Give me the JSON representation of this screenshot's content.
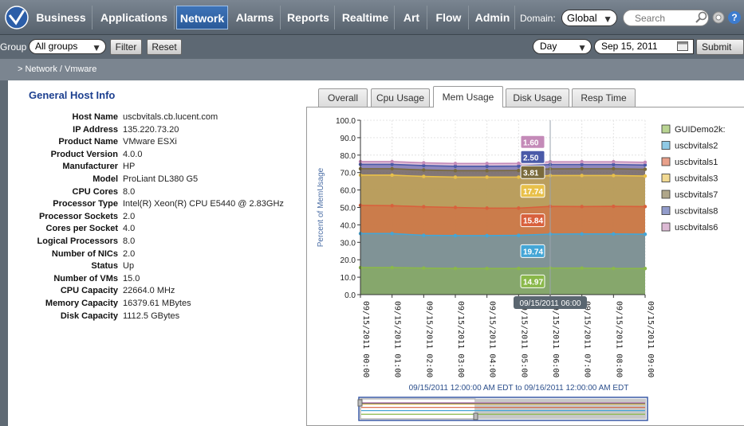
{
  "nav": {
    "items": [
      "Business",
      "Applications",
      "Network",
      "Alarms",
      "Reports",
      "Realtime",
      "Art",
      "Flow",
      "Admin"
    ],
    "active": "Network",
    "domain_label": "Domain:",
    "domain_value": "Global",
    "search_placeholder": "Search",
    "help_label": "?"
  },
  "filter": {
    "group_label": "Group",
    "group_value": "All groups",
    "filter_button": "Filter",
    "reset_button": "Reset",
    "period_value": "Day",
    "date_value": "Sep 15, 2011",
    "submit_button": "Submit"
  },
  "breadcrumb": "> Network / Vmware",
  "host_info": {
    "title": "General Host Info",
    "rows": [
      {
        "key": "Host Name",
        "value": "uscbvitals.cb.lucent.com"
      },
      {
        "key": "IP Address",
        "value": "135.220.73.20"
      },
      {
        "key": "Product Name",
        "value": "VMware ESXi"
      },
      {
        "key": "Product Version",
        "value": "4.0.0"
      },
      {
        "key": "Manufacturer",
        "value": "HP"
      },
      {
        "key": "Model",
        "value": "ProLiant DL380 G5"
      },
      {
        "key": "CPU Cores",
        "value": "8.0"
      },
      {
        "key": "Processor Type",
        "value": "Intel(R) Xeon(R) CPU E5440 @ 2.83GHz"
      },
      {
        "key": "Processor Sockets",
        "value": "2.0"
      },
      {
        "key": "Cores per Socket",
        "value": "4.0"
      },
      {
        "key": "Logical Processors",
        "value": "8.0"
      },
      {
        "key": "Number of NICs",
        "value": "2.0"
      },
      {
        "key": "Status",
        "value": "Up"
      },
      {
        "key": "Number of VMs",
        "value": "15.0"
      },
      {
        "key": "CPU Capacity",
        "value": "22664.0 MHz"
      },
      {
        "key": "Memory Capacity",
        "value": "16379.61 MBytes"
      },
      {
        "key": "Disk Capacity",
        "value": "1112.5 GBytes"
      }
    ]
  },
  "tabs": [
    "Overall",
    "Cpu Usage",
    "Mem Usage",
    "Disk Usage",
    "Resp Time"
  ],
  "active_tab": "Mem Usage",
  "chart_data": {
    "type": "area",
    "ylabel": "Percent of MemUsage",
    "ylim": [
      0,
      100
    ],
    "yticks": [
      "100.0",
      "90.0",
      "80.0",
      "70.0",
      "60.0",
      "50.0",
      "40.0",
      "30.0",
      "20.0",
      "10.0",
      "0.0"
    ],
    "x": [
      "09/15/2011 00:00",
      "09/15/2011 01:00",
      "09/15/2011 02:00",
      "09/15/2011 03:00",
      "09/15/2011 04:00",
      "09/15/2011 05:00",
      "09/15/2011 06:00",
      "09/15/2011 07:00",
      "09/15/2011 08:00",
      "09/15/2011 09:00"
    ],
    "series": [
      {
        "name": "GUIDemo2k:",
        "color": "#8ab84a",
        "cum": [
          15.5,
          15.5,
          15.2,
          15.0,
          15.0,
          15.0,
          15.2,
          15.2,
          15.0,
          15.0
        ]
      },
      {
        "name": "uscbvitals2",
        "color": "#44a6d6",
        "cum": [
          35.0,
          35.0,
          34.0,
          33.8,
          33.8,
          34.0,
          34.7,
          34.8,
          34.8,
          34.6
        ]
      },
      {
        "name": "uscbvitals1",
        "color": "#d8603c",
        "cum": [
          51.2,
          51.0,
          50.4,
          50.0,
          49.6,
          49.6,
          50.6,
          50.5,
          50.6,
          50.5
        ]
      },
      {
        "name": "uscbvitals3",
        "color": "#e8c04a",
        "cum": [
          68.5,
          68.5,
          67.8,
          67.4,
          67.4,
          67.4,
          68.3,
          68.3,
          68.3,
          68.0
        ]
      },
      {
        "name": "uscbvitals7",
        "color": "#7a6a3c",
        "cum": [
          72.2,
          72.2,
          71.5,
          71.1,
          71.1,
          71.2,
          72.1,
          72.2,
          72.2,
          71.9
        ]
      },
      {
        "name": "uscbvitals8",
        "color": "#4a5aa8",
        "cum": [
          74.7,
          74.7,
          74.0,
          73.6,
          73.6,
          73.7,
          74.6,
          74.6,
          74.6,
          74.3
        ]
      },
      {
        "name": "uscbvitals6",
        "color": "#c48ab8",
        "cum": [
          76.3,
          76.3,
          75.6,
          75.2,
          75.2,
          75.3,
          76.2,
          76.2,
          76.2,
          75.9
        ]
      }
    ],
    "tooltip_index": 6,
    "tooltip_values": [
      "14.97",
      "19.74",
      "15.84",
      "17.74",
      "3.81",
      "2.50",
      "1.60"
    ],
    "hover_label": "09/15/2011 06:00",
    "range_label": "09/15/2011 12:00:00 AM EDT to 09/16/2011 12:00:00 AM EDT"
  }
}
